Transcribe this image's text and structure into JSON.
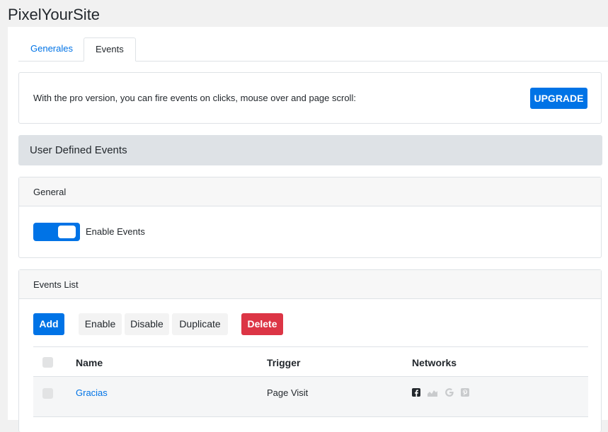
{
  "app": {
    "title": "PixelYourSite"
  },
  "tabs": [
    {
      "label": "Generales"
    },
    {
      "label": "Events"
    }
  ],
  "pro_banner": {
    "text": "With the pro version, you can fire events on clicks, mouse over and page scroll:",
    "upgrade_label": "UPGRADE"
  },
  "section": {
    "title": "User Defined Events"
  },
  "general": {
    "title": "General",
    "toggle": {
      "label": "Enable Events",
      "on": true
    }
  },
  "events_list": {
    "title": "Events List",
    "actions": {
      "add": "Add",
      "enable": "Enable",
      "disable": "Disable",
      "duplicate": "Duplicate",
      "delete": "Delete"
    },
    "columns": [
      "Name",
      "Trigger",
      "Networks"
    ],
    "rows": [
      {
        "name": "Gracias",
        "trigger": "Page Visit",
        "networks": [
          "facebook-icon",
          "analytics-icon",
          "google-icon",
          "pinterest-icon"
        ]
      }
    ]
  },
  "colors": {
    "primary": "#0073e6",
    "danger": "#dc3545",
    "section_bg": "#dee2e6"
  }
}
